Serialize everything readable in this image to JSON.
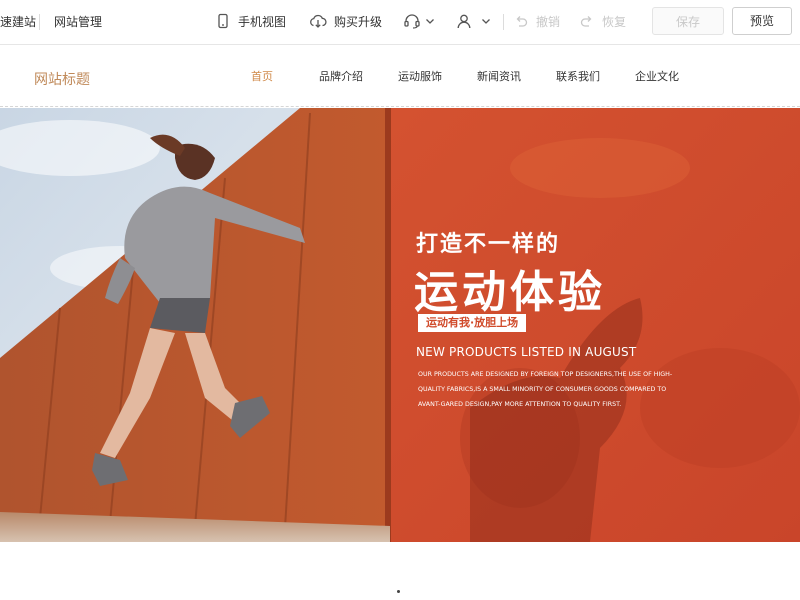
{
  "toolbar": {
    "brand_fragment": "速建站",
    "site_manage": "网站管理",
    "mobile_view": "手机视图",
    "buy_upgrade": "购买升级",
    "undo": "撤销",
    "redo": "恢复",
    "save": "保存",
    "preview": "预览",
    "icons": [
      "phone-icon",
      "cloud-download-icon",
      "headset-icon",
      "user-icon",
      "undo-icon",
      "redo-icon"
    ]
  },
  "site": {
    "title": "网站标题",
    "nav": [
      "首页",
      "品牌介绍",
      "运动服饰",
      "新闻资讯",
      "联系我们",
      "企业文化"
    ]
  },
  "banner": {
    "line1": "打造不一样的",
    "line2": "运动体验",
    "tag": "运动有我·放胆上场",
    "english_title": "NEW PRODUCTS LISTED IN AUGUST",
    "english_body": "OUR PRODUCTS ARE DESIGNED BY FOREIGN TOP DESIGNERS,THE USE OF HIGH-QUALITY FABRICS,IS A SMALL MINORITY OF CONSUMER GOODS COMPARED TO AVANT-GARED DESIGN,PAY MORE ATTENTION TO QUALITY FIRST."
  },
  "colors": {
    "accent_nav": "#d08a4a",
    "site_title": "#c08a5a",
    "banner_orange": "#d4502c"
  }
}
